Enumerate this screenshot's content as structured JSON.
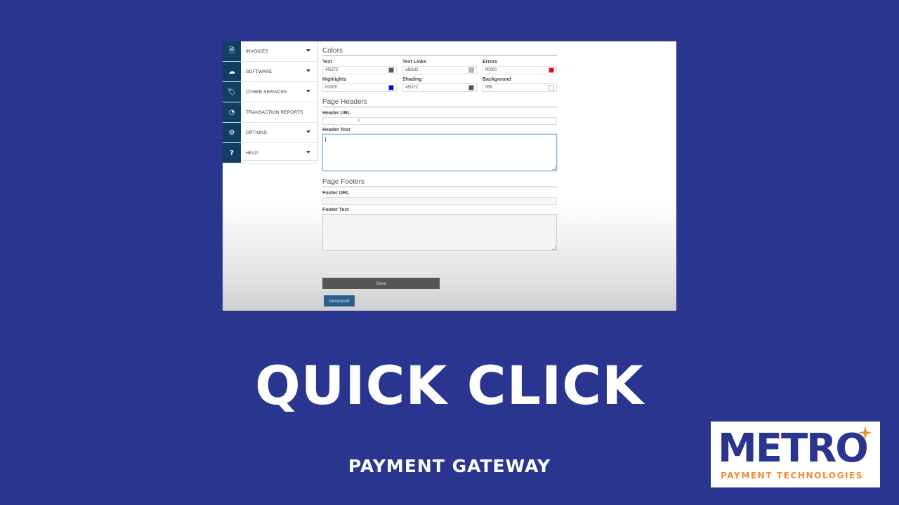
{
  "sidebar": {
    "items": [
      {
        "label": "INVOICES",
        "icon": "document-icon",
        "glyph": "🗎",
        "has_caret": true
      },
      {
        "label": "SOFTWARE",
        "icon": "cloud-icon",
        "glyph": "☁",
        "has_caret": true
      },
      {
        "label": "OTHER SERVICES",
        "icon": "tags-icon",
        "glyph": "🏷",
        "has_caret": true
      },
      {
        "label": "TRANSACTION REPORTS",
        "icon": "pie-chart-icon",
        "glyph": "◔",
        "has_caret": false
      },
      {
        "label": "OPTIONS",
        "icon": "gears-icon",
        "glyph": "⚙",
        "has_caret": true
      },
      {
        "label": "HELP",
        "icon": "question-icon",
        "glyph": "?",
        "has_caret": true
      }
    ]
  },
  "colors_section": {
    "title": "Colors",
    "fields": [
      {
        "label": "Text",
        "value": "4f5372",
        "swatch": "#4f5372"
      },
      {
        "label": "Text Links",
        "value": "afb3d2",
        "swatch": "#afb3d2"
      },
      {
        "label": "Errors",
        "value": "ff0000",
        "swatch": "#ff0000"
      },
      {
        "label": "Highlights",
        "value": "0000ff",
        "swatch": "#0000ff"
      },
      {
        "label": "Shading",
        "value": "4f5372",
        "swatch": "#4f5372"
      },
      {
        "label": "Background",
        "value": "ffffff",
        "swatch": "#ffffff"
      }
    ]
  },
  "headers_section": {
    "title": "Page Headers",
    "url_label": "Header URL",
    "url_value": "",
    "text_label": "Header Text",
    "text_value": ""
  },
  "footers_section": {
    "title": "Page Footers",
    "url_label": "Footer URL",
    "url_value": "",
    "text_label": "Footer Text",
    "text_value": ""
  },
  "buttons": {
    "save_label": "Save",
    "advanced_label": "Advanced"
  },
  "headline": "QUICK CLICK",
  "subline": "PAYMENT GATEWAY",
  "logo": {
    "word": "METRO",
    "sub": "PAYMENT TECHNOLOGIES",
    "primary_color": "#2a3590",
    "accent_color": "#f08c2a"
  }
}
